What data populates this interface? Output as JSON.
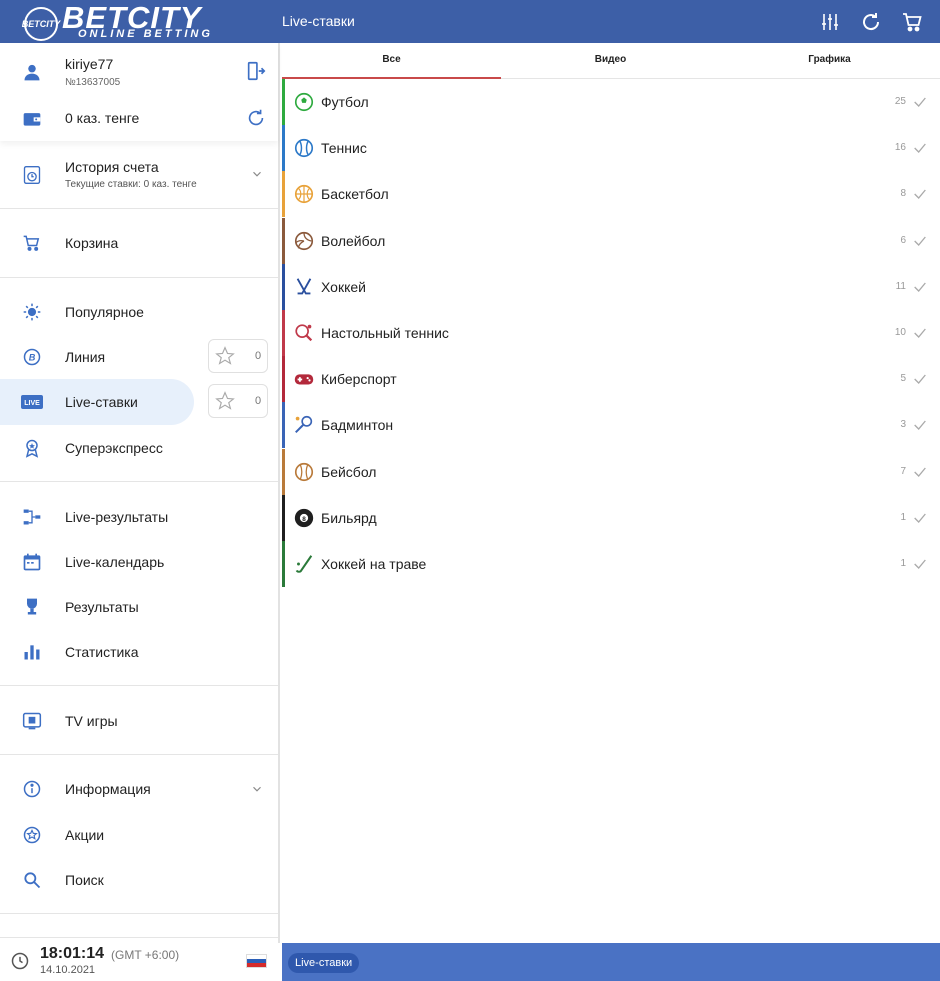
{
  "header": {
    "logo_main": "BETCITY",
    "logo_sub": "ONLINE BETTING",
    "logo_badge": "BETCITY",
    "title": "Live-ставки"
  },
  "account": {
    "username": "kiriye77",
    "user_id": "№13637005",
    "balance": "0 каз. тенге"
  },
  "nav": {
    "history": "История счета",
    "history_sub": "Текущие ставки: 0 каз. тенге",
    "cart": "Корзина",
    "popular": "Популярное",
    "line": "Линия",
    "line_fav_count": "0",
    "live": "Live-ставки",
    "live_fav_count": "0",
    "superexpress": "Суперэкспресс",
    "live_results": "Live-результаты",
    "live_calendar": "Live-календарь",
    "results": "Результаты",
    "statistics": "Статистика",
    "tv_games": "TV игры",
    "information": "Информация",
    "promotions": "Акции",
    "search": "Поиск"
  },
  "clock": {
    "time": "18:01:14",
    "gmt": "(GMT +6:00)",
    "date": "14.10.2021"
  },
  "tabs": [
    "Все",
    "Видео",
    "Графика"
  ],
  "sports": [
    {
      "name": "Футбол",
      "count": "25",
      "color": "#2eaa3f",
      "icon": "soccer-ball-icon"
    },
    {
      "name": "Теннис",
      "count": "16",
      "color": "#2c79c8",
      "icon": "tennis-ball-icon"
    },
    {
      "name": "Баскетбол",
      "count": "8",
      "color": "#e8a23a",
      "icon": "basketball-icon"
    },
    {
      "name": "Волейбол",
      "count": "6",
      "color": "#8b5a3c",
      "icon": "volleyball-icon"
    },
    {
      "name": "Хоккей",
      "count": "11",
      "color": "#2a4f9e",
      "icon": "hockey-sticks-icon"
    },
    {
      "name": "Настольный теннис",
      "count": "10",
      "color": "#c0394a",
      "icon": "table-tennis-icon"
    },
    {
      "name": "Киберспорт",
      "count": "5",
      "color": "#b3293b",
      "icon": "esports-icon"
    },
    {
      "name": "Бадминтон",
      "count": "3",
      "color": "#3a64b6",
      "icon": "badminton-icon"
    },
    {
      "name": "Бейсбол",
      "count": "7",
      "color": "#b97a3a",
      "icon": "baseball-icon"
    },
    {
      "name": "Бильярд",
      "count": "1",
      "color": "#1f1f1f",
      "icon": "billiard-ball-icon"
    },
    {
      "name": "Хоккей на траве",
      "count": "1",
      "color": "#2b7a3a",
      "icon": "field-hockey-icon"
    }
  ],
  "status_bar": {
    "chip": "Live-ставки"
  },
  "colors": {
    "header_bg": "#3d5fa7",
    "icon_blue": "#3d6fc4",
    "active_bg": "#e7f0fb",
    "tab_underline": "#c94a4a",
    "status_bar_bg": "#4a72c4"
  }
}
